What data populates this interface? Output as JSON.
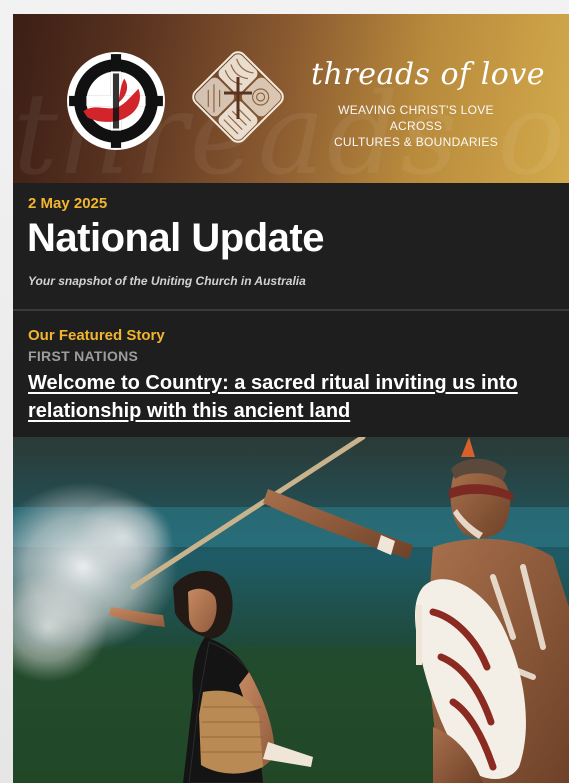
{
  "banner": {
    "watermark": "threads of love",
    "title": "threads of love",
    "tagline_line1": "WEAVING CHRIST'S LOVE ACROSS",
    "tagline_line2": "CULTURES & BOUNDARIES",
    "logo_left_icon": "uniting-church-logo",
    "logo_mid_icon": "threads-of-love-emblem"
  },
  "header": {
    "date": "2 May 2025",
    "title": "National Update",
    "subtitle": "Your snapshot of the Uniting Church in Australia"
  },
  "featured": {
    "label": "Our Featured Story",
    "category": "FIRST NATIONS",
    "headline": "Welcome to Country: a sacred ritual inviting us into relationship with this ancient land"
  },
  "colors": {
    "accent": "#f2b530",
    "background": "#1e1e1e",
    "text": "#ffffff",
    "muted": "#9d9d9d",
    "uca_red": "#d2252b"
  },
  "hero": {
    "icon": "welcome-to-country-photo"
  }
}
